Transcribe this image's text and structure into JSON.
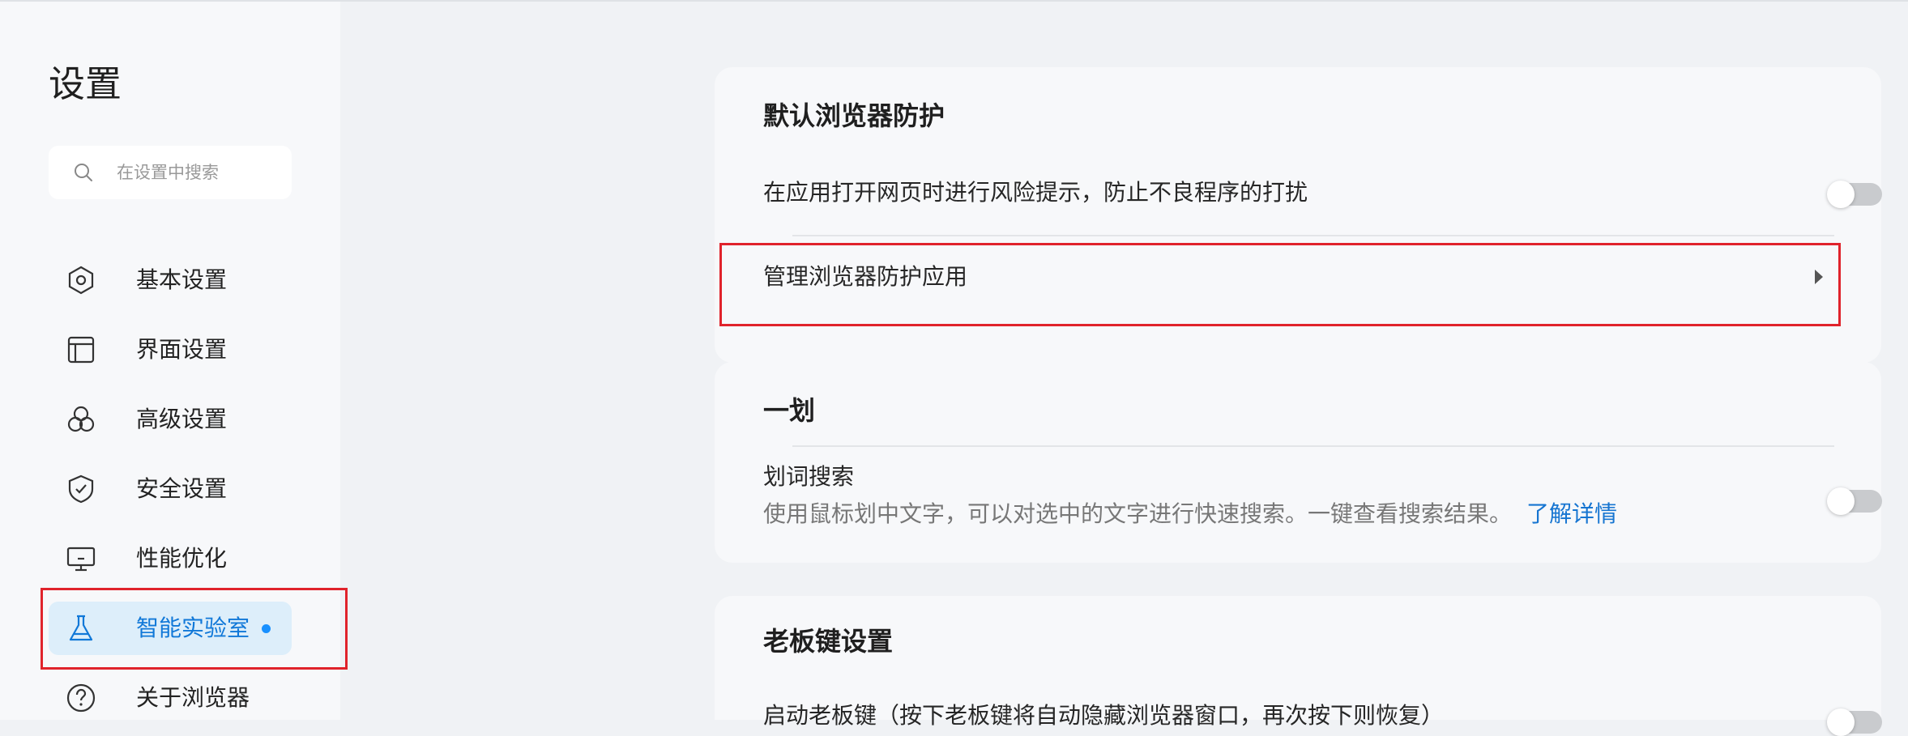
{
  "sidebar": {
    "title": "设置",
    "search": {
      "placeholder": "在设置中搜索",
      "value": ""
    },
    "items": [
      {
        "label": "基本设置",
        "icon": "hexagon-settings-icon"
      },
      {
        "label": "界面设置",
        "icon": "window-icon"
      },
      {
        "label": "高级设置",
        "icon": "three-circles-icon"
      },
      {
        "label": "安全设置",
        "icon": "shield-check-icon"
      },
      {
        "label": "性能优化",
        "icon": "monitor-icon"
      },
      {
        "label": "智能实验室",
        "icon": "flask-icon",
        "active": true,
        "has_dot": true
      },
      {
        "label": "关于浏览器",
        "icon": "question-circle-icon"
      }
    ]
  },
  "sections": {
    "default_protect": {
      "title": "默认浏览器防护",
      "risk_hint_label": "在应用打开网页时进行风险提示，防止不良程序的打扰",
      "risk_hint_enabled": false,
      "manage_label": "管理浏览器防护应用"
    },
    "yihua": {
      "title": "一划",
      "word_search_label": "划词搜索",
      "word_search_desc": "使用鼠标划中文字，可以对选中的文字进行快速搜索。一键查看搜索结果。",
      "learn_more": "了解详情",
      "word_search_enabled": false
    },
    "boss_key": {
      "title": "老板键设置",
      "enable_label": "启动老板键（按下老板键将自动隐藏浏览器窗口，再次按下则恢复）",
      "enabled": false
    }
  },
  "colors": {
    "accent": "#1890ff",
    "highlight_box": "#e0232b",
    "toggle_off": "#c9cbce",
    "link": "#1675d1"
  }
}
